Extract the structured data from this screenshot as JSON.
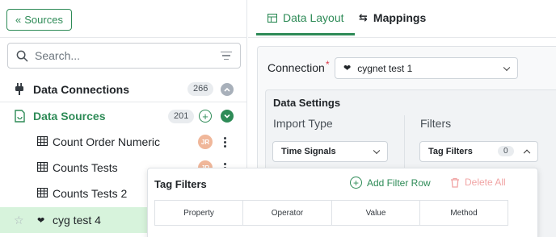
{
  "sidebar": {
    "sources_button": "Sources",
    "search": {
      "placeholder": "Search..."
    },
    "data_connections": {
      "label": "Data Connections",
      "count": "266",
      "icon": "plug-icon"
    },
    "data_sources": {
      "label": "Data Sources",
      "count": "201",
      "icon": "data-source-icon"
    },
    "items": [
      {
        "label": "Count Order Numeric",
        "avatar": "JR"
      },
      {
        "label": "Counts Tests",
        "avatar": "JR"
      },
      {
        "label": "Counts Tests 2"
      },
      {
        "label": "cyg test 4",
        "selected": true
      }
    ]
  },
  "tabs": [
    {
      "label": "Data Layout",
      "active": true,
      "icon": "table-icon"
    },
    {
      "label": "Mappings",
      "active": false,
      "icon": "swap-icon"
    }
  ],
  "connection": {
    "label": "Connection",
    "required_mark": "*",
    "value": "cygnet test 1"
  },
  "data_settings": {
    "title": "Data Settings",
    "import_type_label": "Import Type",
    "import_type_value": "Time Signals",
    "filters_label": "Filters",
    "tag_filters_value": "Tag Filters",
    "tag_filters_count": "0"
  },
  "tag_filters_panel": {
    "title": "Tag Filters",
    "add_row": "Add Filter Row",
    "delete_all": "Delete All",
    "columns": [
      "Property",
      "Operator",
      "Value",
      "Method"
    ]
  },
  "colors": {
    "accent": "#2e8b57",
    "selected_row": "#d7f3dc",
    "danger_soft": "#f1a5a5"
  }
}
